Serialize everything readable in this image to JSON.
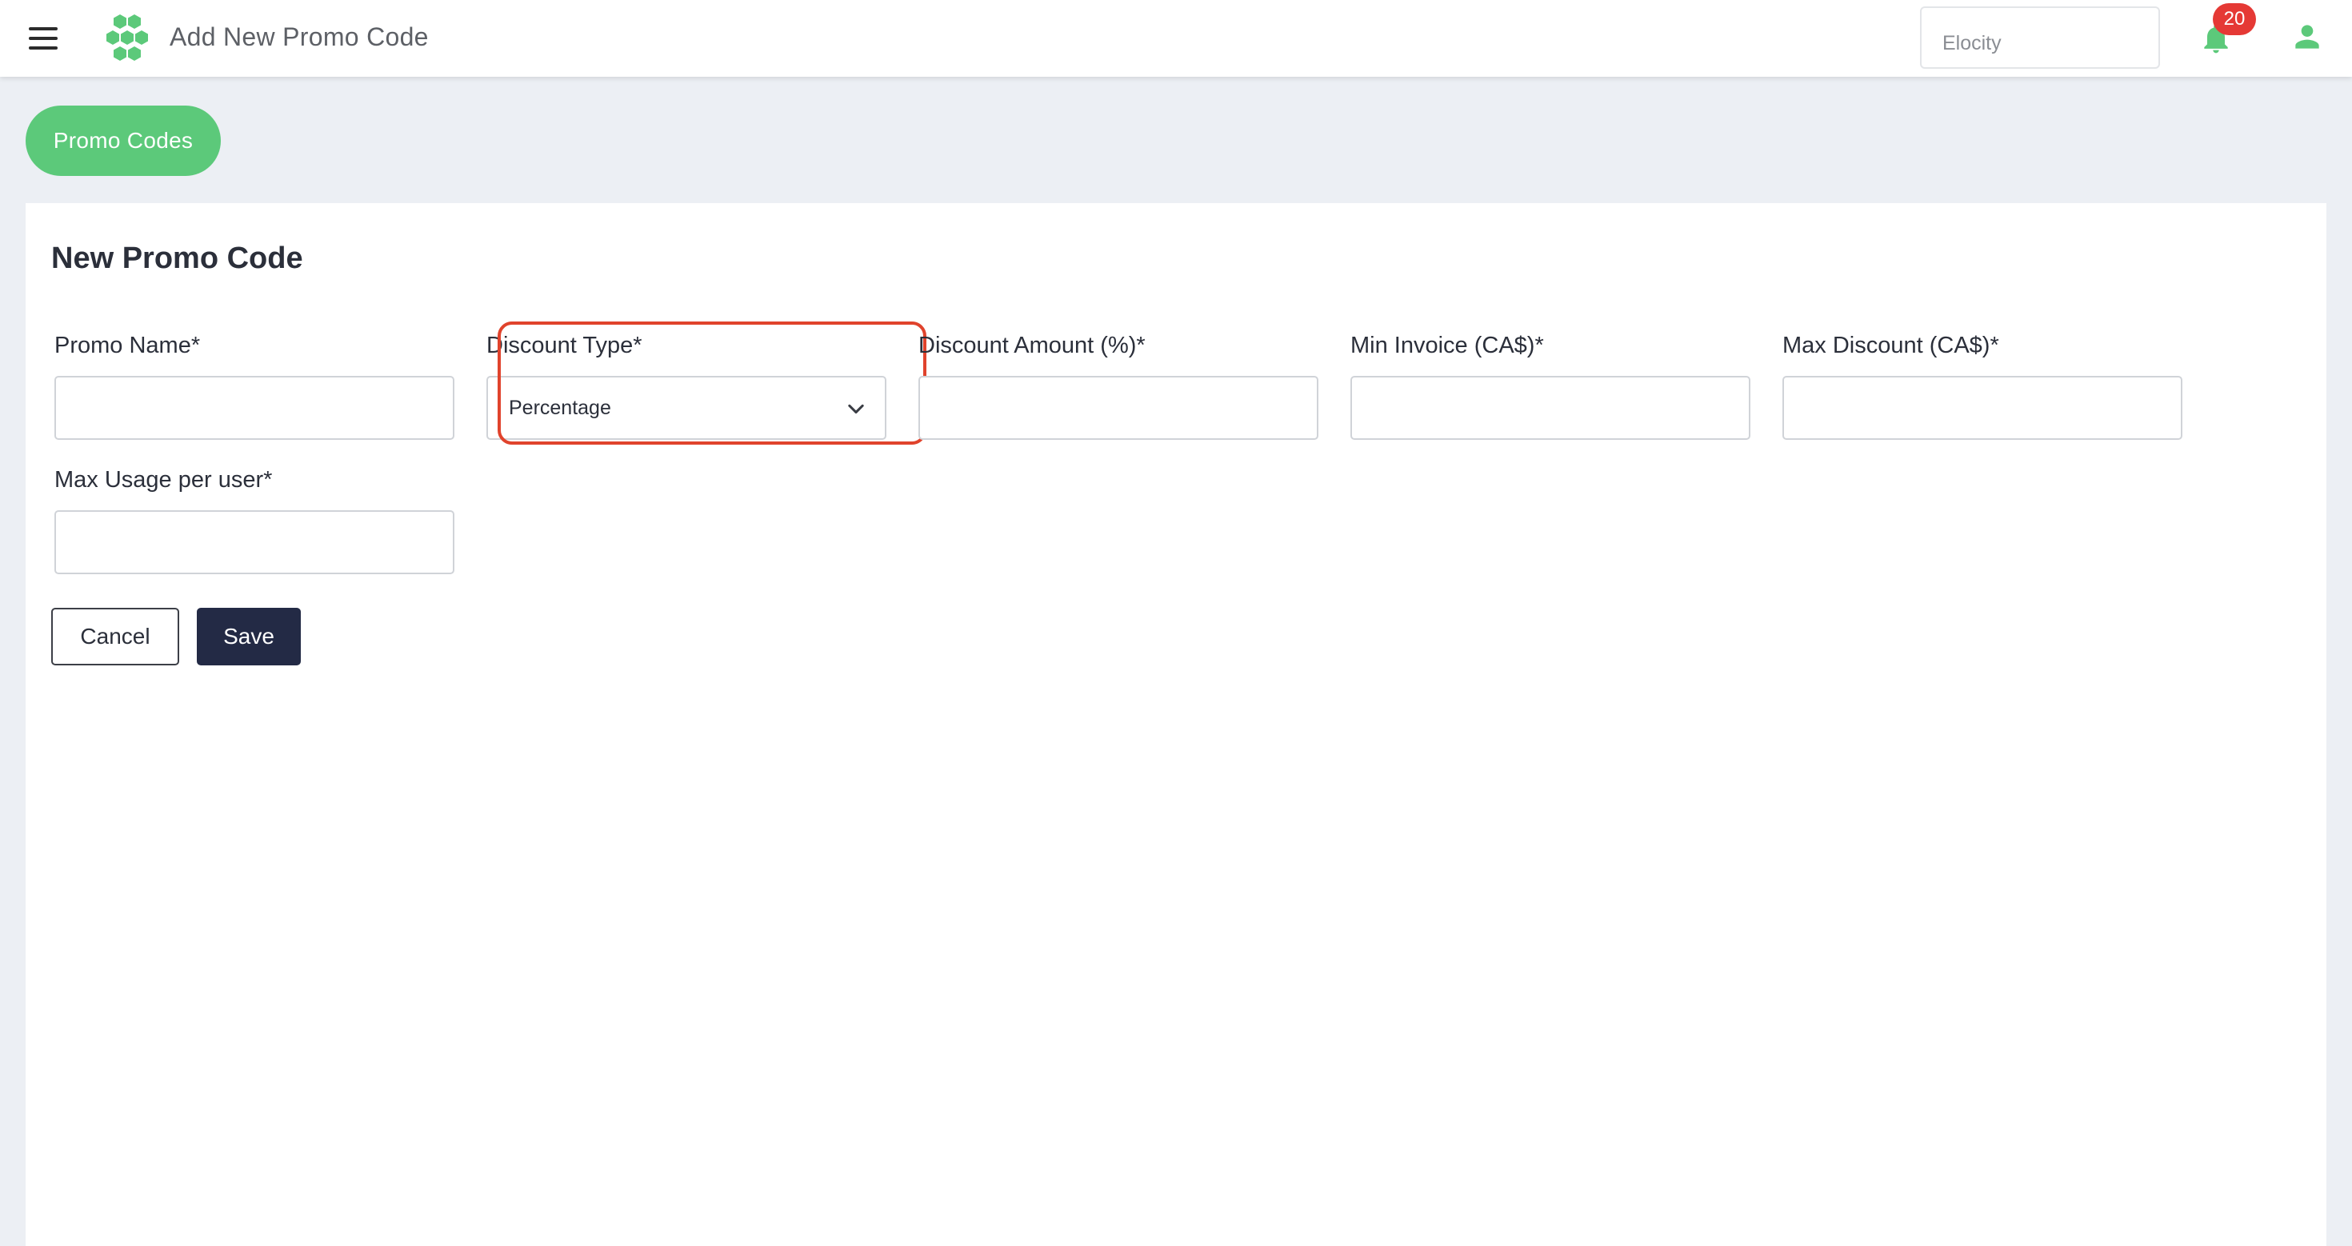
{
  "header": {
    "title": "Add New Promo Code",
    "menu_icon": "hamburger-menu-icon",
    "logo_icon": "hexagon-cluster-logo",
    "org_select_value": "Elocity",
    "notifications_count": "20",
    "bell_icon": "bell-icon",
    "user_icon": "user-icon"
  },
  "nav": {
    "promo_codes_label": "Promo Codes"
  },
  "form": {
    "title": "New Promo Code",
    "fields": [
      {
        "label": "Promo Name*",
        "value": "",
        "type": "text"
      },
      {
        "label": "Discount Type*",
        "value": "Percentage",
        "type": "select"
      },
      {
        "label": "Discount Amount (%)*",
        "value": "",
        "type": "text"
      },
      {
        "label": "Min Invoice (CA$)*",
        "value": "",
        "type": "text"
      },
      {
        "label": "Max Discount (CA$)*",
        "value": "",
        "type": "text"
      },
      {
        "label": "Max Usage per user*",
        "value": "",
        "type": "text"
      }
    ],
    "cancel_label": "Cancel",
    "save_label": "Save"
  },
  "colors": {
    "accent_green": "#5cc97a",
    "save_button": "#232a45",
    "badge_red": "#e53935",
    "highlight_red": "#e0432c"
  }
}
